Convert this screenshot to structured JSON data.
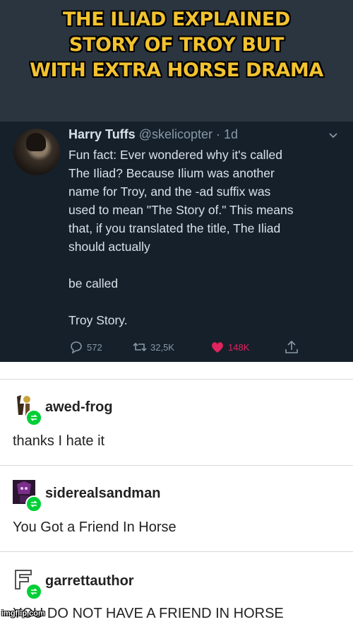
{
  "meme": {
    "title_lines": [
      "THE ILIAD EXPLAINED",
      "STORY OF TROY BUT",
      "WITH EXTRA HORSE DRAMA"
    ]
  },
  "tweet": {
    "name": "Harry Tuffs",
    "handle": "@skelicopter",
    "time": "· 1d",
    "text_lines": [
      "Fun fact: Ever wondered why it's called",
      "The Iliad? Because Ilium was another",
      "name for Troy, and the -ad suffix was",
      "used to mean \"The Story of.\" This means",
      "that, if you translated the title, The Iliad",
      "should actually"
    ],
    "text_line2": "be called",
    "text_line3": "Troy Story.",
    "replies": "572",
    "retweets": "32,5K",
    "likes": "148K",
    "icons": {
      "reply": "reply-icon",
      "retweet": "retweet-icon",
      "like": "heart-icon",
      "share": "share-icon",
      "more": "chevron-down-icon"
    }
  },
  "posts": [
    {
      "username": "awed-frog",
      "body": "thanks I hate it"
    },
    {
      "username": "siderealsandman",
      "body": "You Got a Friend In Horse"
    },
    {
      "username": "garrettauthor",
      "body": "YOU DO NOT HAVE A FRIEND IN HORSE"
    }
  ],
  "watermark": "imgflip.com",
  "colors": {
    "meme_title": "#f2c230",
    "tweet_bg": "#15202b",
    "like": "#e0245e",
    "reblog": "#00cf35"
  }
}
